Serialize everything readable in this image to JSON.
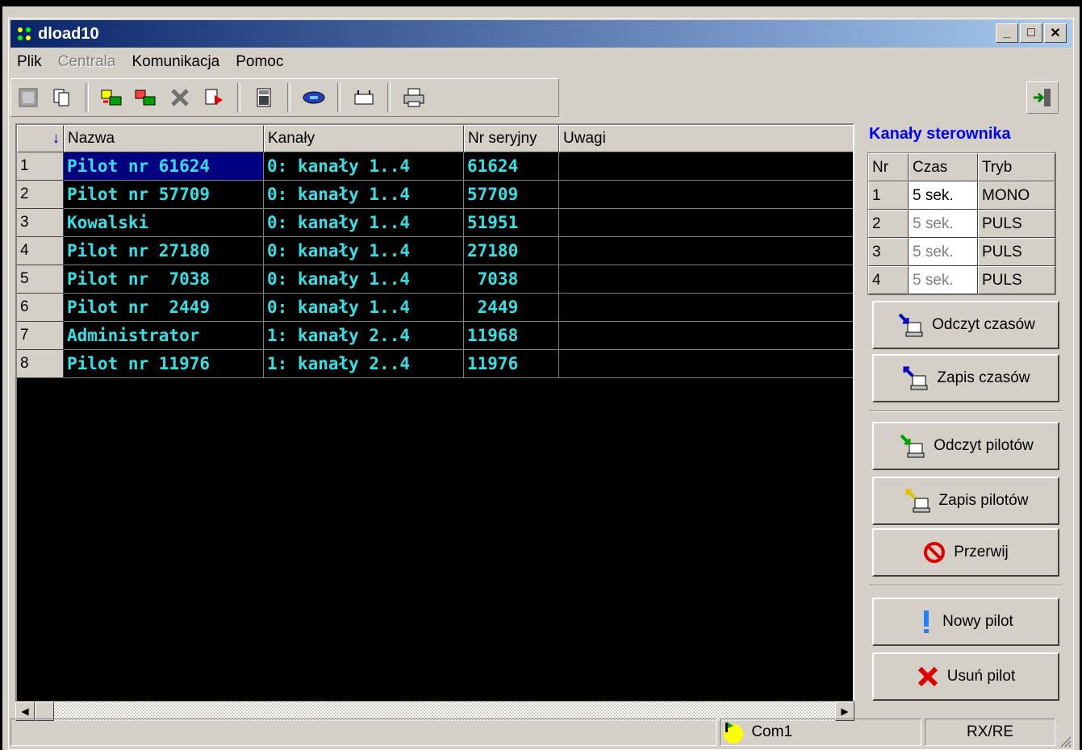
{
  "window": {
    "title": "dload10"
  },
  "menu": [
    {
      "label": "Plik",
      "enabled": true
    },
    {
      "label": "Centrala",
      "enabled": false
    },
    {
      "label": "Komunikacja",
      "enabled": true
    },
    {
      "label": "Pomoc",
      "enabled": true
    }
  ],
  "grid": {
    "headers": [
      "Nazwa",
      "Kanały",
      "Nr seryjny",
      "Uwagi"
    ],
    "sort_indicator": "↓",
    "rows": [
      {
        "nr": "1",
        "name": "Pilot nr 61624",
        "channels": "0: kanały 1..4",
        "serial": "61624",
        "note": ""
      },
      {
        "nr": "2",
        "name": "Pilot nr 57709",
        "channels": "0: kanały 1..4",
        "serial": "57709",
        "note": ""
      },
      {
        "nr": "3",
        "name": "Kowalski",
        "channels": "0: kanały 1..4",
        "serial": "51951",
        "note": ""
      },
      {
        "nr": "4",
        "name": "Pilot nr 27180",
        "channels": "0: kanały 1..4",
        "serial": "27180",
        "note": ""
      },
      {
        "nr": "5",
        "name": "Pilot nr  7038",
        "channels": "0: kanały 1..4",
        "serial": " 7038",
        "note": ""
      },
      {
        "nr": "6",
        "name": "Pilot nr  2449",
        "channels": "0: kanały 1..4",
        "serial": " 2449",
        "note": ""
      },
      {
        "nr": "7",
        "name": "Administrator",
        "channels": "1: kanały 2..4",
        "serial": "11968",
        "note": ""
      },
      {
        "nr": "8",
        "name": "Pilot nr 11976",
        "channels": "1: kanały 2..4",
        "serial": "11976",
        "note": ""
      }
    ]
  },
  "channels_panel": {
    "title": "Kanały sterownika",
    "headers": [
      "Nr",
      "Czas",
      "Tryb"
    ],
    "rows": [
      {
        "nr": "1",
        "czas": "5 sek.",
        "tryb": "MONO"
      },
      {
        "nr": "2",
        "czas": "5 sek.",
        "tryb": "PULS"
      },
      {
        "nr": "3",
        "czas": "5 sek.",
        "tryb": "PULS"
      },
      {
        "nr": "4",
        "czas": "5 sek.",
        "tryb": "PULS"
      }
    ]
  },
  "buttons": {
    "read_times": "Odczyt czasów",
    "write_times": "Zapis czasów",
    "read_remotes": "Odczyt pilotów",
    "write_remotes": "Zapis pilotów",
    "abort": "Przerwij",
    "new_remote": "Nowy pilot",
    "delete_remote": "Usuń pilot"
  },
  "status": {
    "port": "Com1",
    "mode": "RX/RE"
  },
  "colors": {
    "grid_text": "#33e0e6",
    "selection": "#000080",
    "panel_title": "#0000ff"
  }
}
